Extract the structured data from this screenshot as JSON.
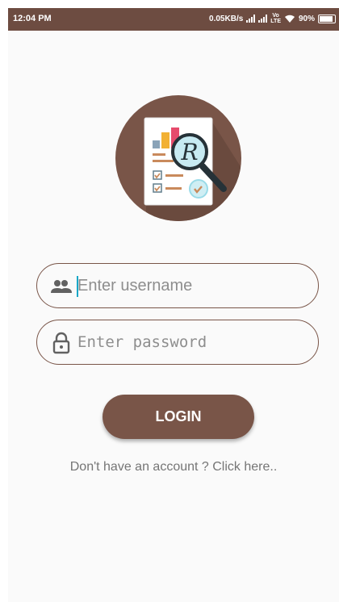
{
  "status_bar": {
    "time": "12:04 PM",
    "network_speed": "0.05KB/s",
    "carrier_label": "Vo\nLTE",
    "battery": "90%"
  },
  "login_form": {
    "username_placeholder": "Enter username",
    "password_placeholder": "Enter password",
    "login_label": "LOGIN",
    "signup_text": "Don't have an account ? Click here.."
  },
  "logo": {
    "letter": "R"
  },
  "colors": {
    "primary": "#795548",
    "status_bar": "#6d4c41",
    "background": "#fafafa",
    "caret": "#19a7c7"
  },
  "icons": [
    "people-icon",
    "lock-icon",
    "report-logo-icon",
    "magnifier-icon",
    "wifi-icon",
    "signal-icon",
    "battery-icon"
  ]
}
